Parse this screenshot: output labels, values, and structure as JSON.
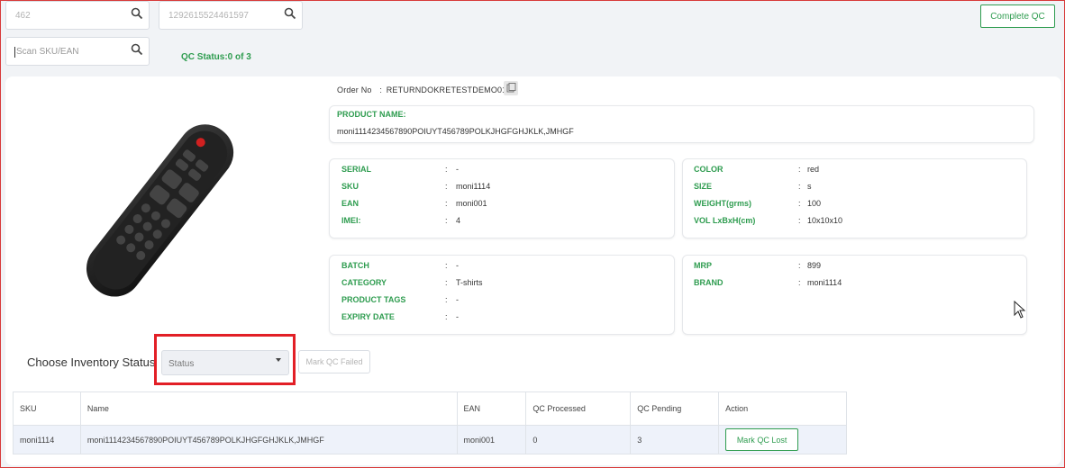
{
  "search": {
    "first_value": "462",
    "second_value": "1292615524461597",
    "scan_placeholder": "Scan SKU/EAN"
  },
  "header": {
    "complete_qc_label": "Complete QC",
    "qc_status": "QC Status:0 of 3"
  },
  "order": {
    "label": "Order No",
    "value": "RETURNDOKRETESTDEMO01",
    "separator": ":"
  },
  "product": {
    "name_label": "PRODUCT NAME:",
    "name_value": "moni1114234567890POIUYT456789POLKJHGFGHJKLK,JMHGF"
  },
  "details_left_top": [
    {
      "label": "SERIAL",
      "value": "-"
    },
    {
      "label": "SKU",
      "value": "moni1114"
    },
    {
      "label": "EAN",
      "value": "moni001"
    },
    {
      "label": "IMEI:",
      "value": "4"
    }
  ],
  "details_right_top": [
    {
      "label": "COLOR",
      "value": "red"
    },
    {
      "label": "SIZE",
      "value": "s"
    },
    {
      "label": "WEIGHT(grms)",
      "value": "100"
    },
    {
      "label": "VOL LxBxH(cm)",
      "value": "10x10x10"
    }
  ],
  "details_left_bottom": [
    {
      "label": "BATCH",
      "value": "-"
    },
    {
      "label": "CATEGORY",
      "value": "T-shirts"
    },
    {
      "label": "PRODUCT TAGS",
      "value": "-"
    },
    {
      "label": "EXPIRY DATE",
      "value": "-"
    }
  ],
  "details_right_bottom": [
    {
      "label": "MRP",
      "value": "899"
    },
    {
      "label": "BRAND",
      "value": "moni1114"
    }
  ],
  "inventory": {
    "label": "Choose Inventory Status",
    "select_value": "Status",
    "mark_failed_label": "Mark QC Failed"
  },
  "table": {
    "headers": [
      "SKU",
      "Name",
      "EAN",
      "QC Processed",
      "QC Pending",
      "Action"
    ],
    "rows": [
      {
        "sku": "moni1114",
        "name": "moni1114234567890POIUYT456789POLKJHGFGHJKLK,JMHGF",
        "ean": "moni001",
        "processed": "0",
        "pending": "3",
        "action": "Mark QC Lost"
      }
    ]
  },
  "colors": {
    "accent_green": "#2e9c4f",
    "highlight_red": "#e21f26"
  }
}
